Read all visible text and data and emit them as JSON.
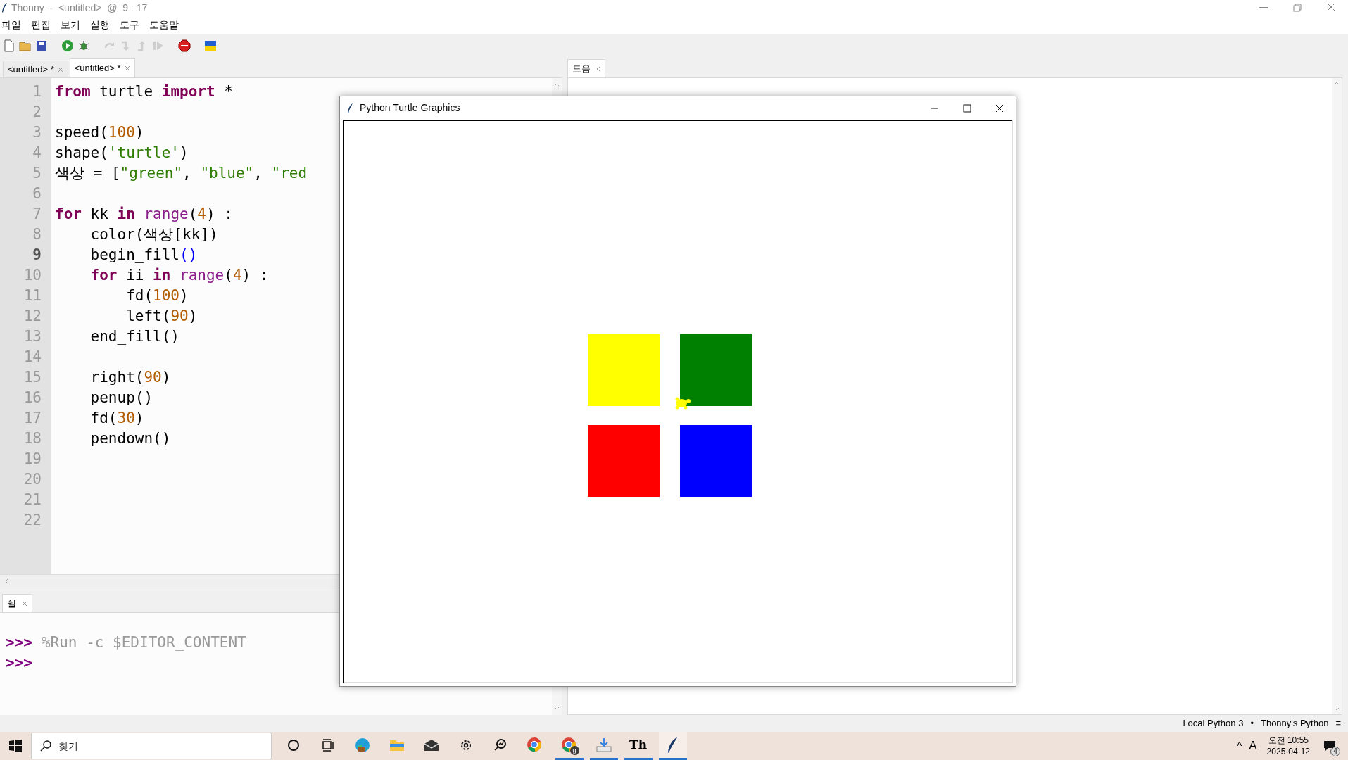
{
  "window": {
    "title": "Thonny  -  <untitled>  @  9 : 17"
  },
  "menu": [
    "파일",
    "편집",
    "보기",
    "실행",
    "도구",
    "도움말"
  ],
  "toolbar": [
    {
      "kind": "new",
      "disabled": false
    },
    {
      "kind": "open",
      "disabled": false
    },
    {
      "kind": "save",
      "disabled": false
    },
    {
      "kind": "run",
      "disabled": false
    },
    {
      "kind": "debug",
      "disabled": false
    },
    {
      "kind": "step_over",
      "disabled": true
    },
    {
      "kind": "step_into",
      "disabled": true
    },
    {
      "kind": "step_out",
      "disabled": true
    },
    {
      "kind": "resume",
      "disabled": true
    },
    {
      "kind": "stop",
      "disabled": false
    },
    {
      "kind": "flag",
      "disabled": false
    }
  ],
  "editor_tabs": [
    {
      "label": "<untitled> *",
      "selected": false
    },
    {
      "label": "<untitled> *",
      "selected": true
    }
  ],
  "editor": {
    "lines": [
      {
        "number": "1",
        "current": false,
        "tokens": [
          {
            "kind": "kw",
            "text": "from"
          },
          {
            "kind": "plain",
            "text": " turtle "
          },
          {
            "kind": "kw",
            "text": "import"
          },
          {
            "kind": "plain",
            "text": " *"
          }
        ]
      },
      {
        "number": "2",
        "current": false
      },
      {
        "number": "3",
        "current": false,
        "tokens": [
          {
            "kind": "plain",
            "text": "speed("
          },
          {
            "kind": "num",
            "text": "100"
          },
          {
            "kind": "plain",
            "text": ")"
          }
        ]
      },
      {
        "number": "4",
        "current": false,
        "tokens": [
          {
            "kind": "plain",
            "text": "shape("
          },
          {
            "kind": "str",
            "text": "'turtle'"
          },
          {
            "kind": "plain",
            "text": ")"
          }
        ]
      },
      {
        "number": "5",
        "current": false,
        "tokens": [
          {
            "kind": "plain",
            "text": "색상 = ["
          },
          {
            "kind": "str",
            "text": "\"green\""
          },
          {
            "kind": "plain",
            "text": ", "
          },
          {
            "kind": "str",
            "text": "\"blue\""
          },
          {
            "kind": "plain",
            "text": ", "
          },
          {
            "kind": "str",
            "text": "\"red"
          }
        ]
      },
      {
        "number": "6",
        "current": false
      },
      {
        "number": "7",
        "current": false,
        "tokens": [
          {
            "kind": "kw",
            "text": "for"
          },
          {
            "kind": "plain",
            "text": " kk "
          },
          {
            "kind": "kw",
            "text": "in "
          },
          {
            "kind": "builtin",
            "text": "range"
          },
          {
            "kind": "plain",
            "text": "("
          },
          {
            "kind": "num",
            "text": "4"
          },
          {
            "kind": "plain",
            "text": ") :"
          }
        ]
      },
      {
        "number": "8",
        "current": false,
        "tokens": [
          {
            "kind": "plain",
            "text": "    color(색상[kk])"
          }
        ]
      },
      {
        "number": "9",
        "current": true,
        "tokens": [
          {
            "kind": "plain",
            "text": "    begin_fill"
          },
          {
            "kind": "match",
            "text": "()"
          }
        ]
      },
      {
        "number": "10",
        "current": false,
        "tokens": [
          {
            "kind": "kw",
            "text": "    for"
          },
          {
            "kind": "plain",
            "text": " ii "
          },
          {
            "kind": "kw",
            "text": "in "
          },
          {
            "kind": "builtin",
            "text": "range"
          },
          {
            "kind": "plain",
            "text": "("
          },
          {
            "kind": "num",
            "text": "4"
          },
          {
            "kind": "plain",
            "text": ") :"
          }
        ]
      },
      {
        "number": "11",
        "current": false,
        "tokens": [
          {
            "kind": "plain",
            "text": "        fd("
          },
          {
            "kind": "num",
            "text": "100"
          },
          {
            "kind": "plain",
            "text": ")"
          }
        ]
      },
      {
        "number": "12",
        "current": false,
        "tokens": [
          {
            "kind": "plain",
            "text": "        left("
          },
          {
            "kind": "num",
            "text": "90"
          },
          {
            "kind": "plain",
            "text": ")"
          }
        ]
      },
      {
        "number": "13",
        "current": false,
        "tokens": [
          {
            "kind": "plain",
            "text": "    end_fill()"
          }
        ]
      },
      {
        "number": "14",
        "current": false
      },
      {
        "number": "15",
        "current": false,
        "tokens": [
          {
            "kind": "plain",
            "text": "    right("
          },
          {
            "kind": "num",
            "text": "90"
          },
          {
            "kind": "plain",
            "text": ")"
          }
        ]
      },
      {
        "number": "16",
        "current": false,
        "tokens": [
          {
            "kind": "plain",
            "text": "    penup()"
          }
        ]
      },
      {
        "number": "17",
        "current": false,
        "tokens": [
          {
            "kind": "plain",
            "text": "    fd("
          },
          {
            "kind": "num",
            "text": "30"
          },
          {
            "kind": "plain",
            "text": ")"
          }
        ]
      },
      {
        "number": "18",
        "current": false,
        "tokens": [
          {
            "kind": "plain",
            "text": "    pendown()"
          }
        ]
      },
      {
        "number": "19",
        "current": false
      },
      {
        "number": "20",
        "current": false
      },
      {
        "number": "21",
        "current": false
      },
      {
        "number": "22",
        "current": false
      }
    ]
  },
  "shell": {
    "tab": {
      "label": "쉘",
      "selected": true
    },
    "lines": [
      {
        "prompt": ">>>",
        "command": "%Run -c $EDITOR_CONTENT"
      },
      {
        "prompt": ">>>"
      }
    ]
  },
  "help_panel": {
    "tab": {
      "label": "도움",
      "selected": true
    }
  },
  "turtle_window": {
    "title": "Python Turtle Graphics",
    "squares": [
      {
        "color": "#ffff00"
      },
      {
        "color": "#008000"
      },
      {
        "color": "#ff0000"
      },
      {
        "color": "#0000ff"
      }
    ]
  },
  "status_bar": {
    "interpreter": "Local Python 3",
    "separator": "•",
    "backend": "Thonny's Python",
    "menu": "≡"
  },
  "taskbar": {
    "search": {
      "placeholder": "찾기"
    },
    "apps": [
      {
        "kind": "cortana",
        "running": false
      },
      {
        "kind": "taskview",
        "running": false
      },
      {
        "kind": "edge",
        "running": false
      },
      {
        "kind": "explorer",
        "running": false
      },
      {
        "kind": "mail",
        "running": false
      },
      {
        "kind": "settings",
        "running": false
      },
      {
        "kind": "search_app",
        "running": false
      },
      {
        "kind": "chrome",
        "running": false
      },
      {
        "kind": "chrome_profile",
        "running": true,
        "badge": "g"
      },
      {
        "kind": "download",
        "running": true
      },
      {
        "kind": "text_app",
        "running": true,
        "label": "Th"
      },
      {
        "kind": "thonny",
        "running": true
      }
    ],
    "tray": {
      "chevron": "^",
      "ime": "A",
      "time": "오전 10:55",
      "date": "2025-04-12",
      "notifications": "4"
    }
  }
}
